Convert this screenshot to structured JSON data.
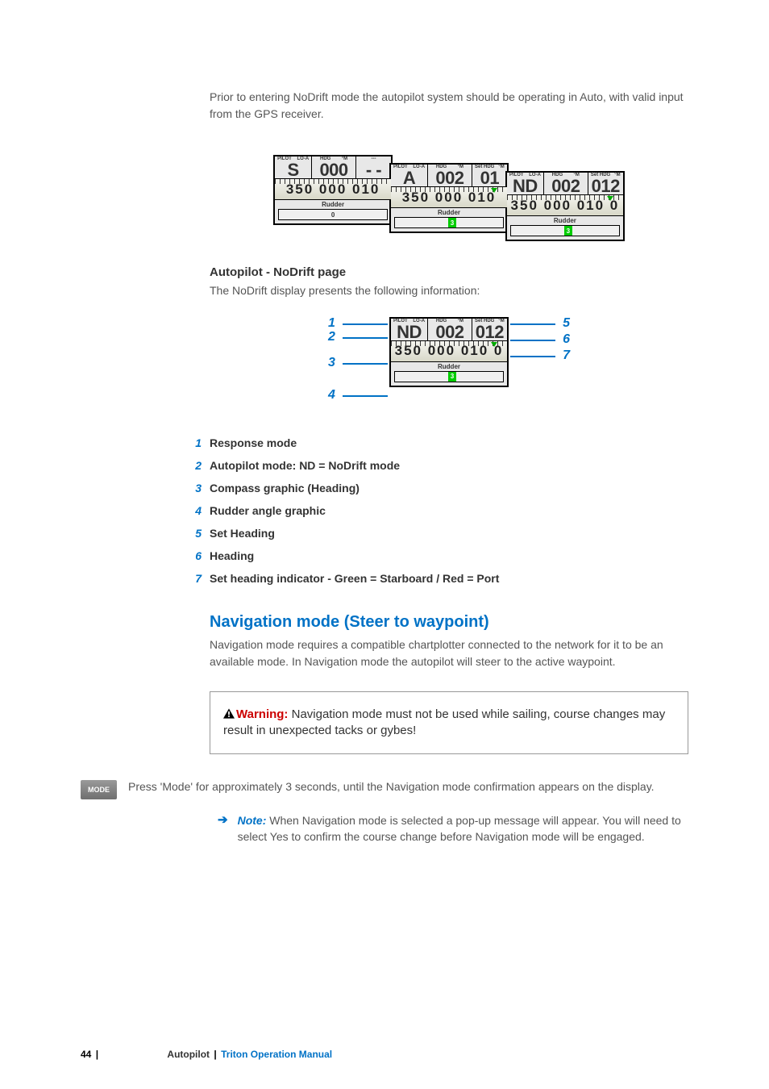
{
  "intro": "Prior to entering NoDrift mode the autopilot system should be operating in Auto, with valid input from the GPS receiver.",
  "panels": {
    "step1": {
      "pilot_lbl": "PILOT",
      "lo_a_lbl": "LO-A",
      "hdg_lbl": "HDG",
      "m_lbl": "°M",
      "dash_lbl": "---",
      "mode": "S",
      "hdg_val": "000",
      "right_val": "- -",
      "compass": "350  000  010",
      "rudder_lbl": "Rudder",
      "rudder_val": "0"
    },
    "step2": {
      "pilot_lbl": "PILOT",
      "lo_a_lbl": "LO-A",
      "hdg_lbl": "HDG",
      "m_lbl": "°M",
      "set_lbl": "Set HDG",
      "m2_lbl": "°M",
      "mode": "A",
      "hdg_val": "002",
      "set_val": "01",
      "compass": "350  000  010",
      "rudder_lbl": "Rudder",
      "rudder_val": "3"
    },
    "step3": {
      "pilot_lbl": "PILOT",
      "lo_a_lbl": "LO-A",
      "hdg_lbl": "HDG",
      "m_lbl": "°M",
      "set_lbl": "Set HDG",
      "m2_lbl": "°M",
      "mode": "ND",
      "hdg_val": "002",
      "set_val": "012",
      "compass": "350  000  010  0",
      "rudder_lbl": "Rudder",
      "rudder_val": "3"
    }
  },
  "section": {
    "title": "Autopilot - NoDrift page",
    "sub": "The NoDrift display presents the following information:"
  },
  "anno_panel": {
    "pilot_lbl": "PILOT",
    "lo_a_lbl": "LO-A",
    "hdg_lbl": "HDG",
    "m_lbl": "°M",
    "set_lbl": "Set HDG",
    "m2_lbl": "°M",
    "mode": "ND",
    "hdg_val": "002",
    "set_val": "012",
    "compass": "350  000  010  0",
    "rudder_lbl": "Rudder",
    "rudder_val": "3"
  },
  "anno_nums": {
    "n1": "1",
    "n2": "2",
    "n3": "3",
    "n4": "4",
    "n5": "5",
    "n6": "6",
    "n7": "7"
  },
  "legend": [
    {
      "n": "1",
      "t": "Response mode"
    },
    {
      "n": "2",
      "t": "Autopilot mode: ND = NoDrift mode"
    },
    {
      "n": "3",
      "t": "Compass graphic (Heading)"
    },
    {
      "n": "4",
      "t": "Rudder angle graphic"
    },
    {
      "n": "5",
      "t": "Set Heading"
    },
    {
      "n": "6",
      "t": "Heading"
    },
    {
      "n": "7",
      "t": "Set heading indicator - Green = Starboard / Red = Port"
    }
  ],
  "nav": {
    "heading": "Navigation mode (Steer to waypoint)",
    "text": "Navigation mode requires a compatible chartplotter connected to the network for it to be an available mode. In Navigation mode the autopilot will steer to the active waypoint."
  },
  "warn": {
    "label": "Warning:",
    "text": " Navigation mode must not be used while sailing, course changes may result in unexpected tacks or gybes!"
  },
  "mode_btn": "MODE",
  "mode_text": "Press 'Mode' for approximately 3 seconds, until the Navigation mode confirmation appears on the display.",
  "note": {
    "label": "Note:",
    "text": " When Navigation mode is selected a pop-up message will appear. You will need to select Yes to confirm the course change before Navigation mode will be engaged."
  },
  "footer": {
    "page": "44",
    "sep": "|",
    "chapter": "Autopilot",
    "book": "Triton Operation Manual"
  }
}
